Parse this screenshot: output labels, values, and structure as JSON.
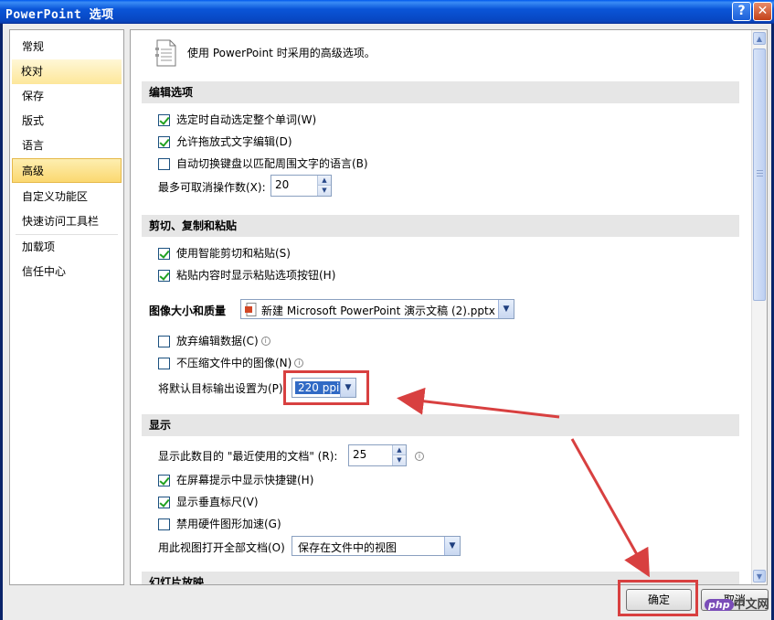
{
  "window": {
    "title": "PowerPoint 选项",
    "help": "?",
    "close": "✕"
  },
  "nav": {
    "items": [
      {
        "label": "常规"
      },
      {
        "label": "校对"
      },
      {
        "label": "保存"
      },
      {
        "label": "版式"
      },
      {
        "label": "语言"
      },
      {
        "label": "高级"
      },
      {
        "label": "自定义功能区"
      },
      {
        "label": "快速访问工具栏"
      },
      {
        "label": "加载项"
      },
      {
        "label": "信任中心"
      }
    ],
    "selected": "高级"
  },
  "header": {
    "text": "使用 PowerPoint 时采用的高级选项。"
  },
  "sections": {
    "edit": {
      "title": "编辑选项",
      "opt1": "选定时自动选定整个单词(W)",
      "opt2": "允许拖放式文字编辑(D)",
      "opt3": "自动切换键盘以匹配周围文字的语言(B)",
      "undo_label": "最多可取消操作数(X):",
      "undo_value": "20"
    },
    "clipboard": {
      "title": "剪切、复制和粘贴",
      "opt1": "使用智能剪切和粘贴(S)",
      "opt2": "粘贴内容时显示粘贴选项按钮(H)"
    },
    "image": {
      "title": "图像大小和质量",
      "file": "新建 Microsoft PowerPoint 演示文稿 (2).pptx",
      "opt1": "放弃编辑数据(C)",
      "opt2": "不压缩文件中的图像(N)",
      "ppi_label": "将默认目标输出设置为(P):",
      "ppi_value": "220 ppi"
    },
    "display": {
      "title": "显示",
      "recent_label": "显示此数目的 \"最近使用的文档\" (R):",
      "recent_value": "25",
      "opt1": "在屏幕提示中显示快捷键(H)",
      "opt2": "显示垂直标尺(V)",
      "opt3": "禁用硬件图形加速(G)",
      "view_label": "用此视图打开全部文档(O)",
      "view_value": "保存在文件中的视图"
    },
    "slideshow": {
      "title": "幻灯片放映"
    }
  },
  "buttons": {
    "ok": "确定",
    "cancel": "取消"
  },
  "watermark": {
    "logo": "php",
    "text": "中文网"
  },
  "colors": {
    "accent_red": "#d84040",
    "nav_selected": "#fbd870",
    "titlebar": "#0a55d8"
  }
}
